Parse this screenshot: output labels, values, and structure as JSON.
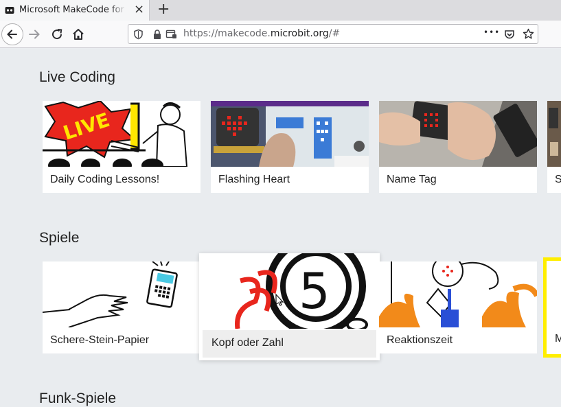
{
  "browser": {
    "tab_title": "Microsoft MakeCode for micro:bit",
    "new_tab_label": "+",
    "close_label": "×",
    "url_prefix": "https://makecode.",
    "url_host": "microbit.org",
    "url_suffix": "/#",
    "url_menu_label": "•••"
  },
  "sections": [
    {
      "title": "Live Coding",
      "cards": [
        "Daily Coding Lessons!",
        "Flashing Heart",
        "Name Tag",
        "S"
      ]
    },
    {
      "title": "Spiele",
      "cards": [
        "Schere-Stein-Papier",
        "Kopf oder Zahl",
        "Reaktionszeit",
        "M"
      ]
    },
    {
      "title": "Funk-Spiele"
    }
  ],
  "colors": {
    "page_bg": "#e9ecef",
    "card_bg": "#ffffff",
    "hover_label_bg": "#eeeeee",
    "highlight_border": "#ffee00",
    "live_red": "#e8261d",
    "live_yellow": "#ffe600"
  }
}
